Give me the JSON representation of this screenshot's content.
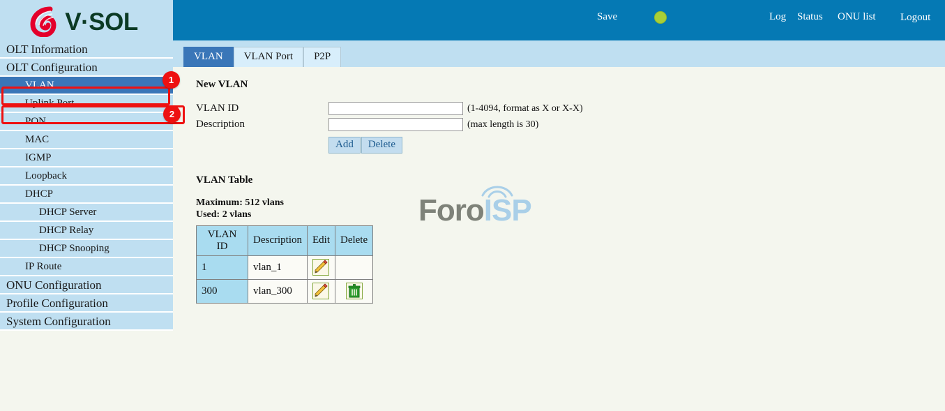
{
  "brand": {
    "logo_text": "V·SOL",
    "logo_icon": "vsol-swirl-logo"
  },
  "header": {
    "save_label": "Save",
    "save_indicator_color": "#a8cf38",
    "links": [
      {
        "label": "Log"
      },
      {
        "label": "Status"
      },
      {
        "label": "ONU list"
      },
      {
        "label": "Logout"
      }
    ]
  },
  "sidebar": {
    "items": [
      {
        "label": "OLT Information",
        "level": 0,
        "selected": false
      },
      {
        "label": "OLT Configuration",
        "level": 0,
        "selected": false
      },
      {
        "label": "VLAN",
        "level": 1,
        "selected": true
      },
      {
        "label": "Uplink Port",
        "level": 1,
        "selected": false
      },
      {
        "label": "PON",
        "level": 1,
        "selected": false
      },
      {
        "label": "MAC",
        "level": 1,
        "selected": false
      },
      {
        "label": "IGMP",
        "level": 1,
        "selected": false
      },
      {
        "label": "Loopback",
        "level": 1,
        "selected": false
      },
      {
        "label": "DHCP",
        "level": 1,
        "selected": false
      },
      {
        "label": "DHCP Server",
        "level": 2,
        "selected": false
      },
      {
        "label": "DHCP Relay",
        "level": 2,
        "selected": false
      },
      {
        "label": "DHCP Snooping",
        "level": 2,
        "selected": false
      },
      {
        "label": "IP Route",
        "level": 1,
        "selected": false
      },
      {
        "label": "ONU Configuration",
        "level": 0,
        "selected": false
      },
      {
        "label": "Profile Configuration",
        "level": 0,
        "selected": false
      },
      {
        "label": "System Configuration",
        "level": 0,
        "selected": false
      }
    ]
  },
  "annotations": {
    "color": "#ee1111",
    "badges": [
      {
        "number": "1",
        "targets": "OLT Configuration"
      },
      {
        "number": "2",
        "targets": "VLAN"
      }
    ]
  },
  "tabs": [
    {
      "label": "VLAN",
      "active": true
    },
    {
      "label": "VLAN Port",
      "active": false
    },
    {
      "label": "P2P",
      "active": false
    }
  ],
  "new_vlan": {
    "title": "New VLAN",
    "fields": [
      {
        "label": "VLAN ID",
        "value": "",
        "placeholder": "",
        "hint": "(1-4094, format as X or X-X)"
      },
      {
        "label": "Description",
        "value": "",
        "placeholder": "",
        "hint": "(max length is 30)"
      }
    ],
    "buttons": [
      {
        "label": "Add"
      },
      {
        "label": "Delete"
      }
    ]
  },
  "vlan_table": {
    "title": "VLAN Table",
    "maximum_line": "Maximum: 512 vlans",
    "used_line": "Used: 2 vlans",
    "columns": [
      "VLAN ID",
      "Description",
      "Edit",
      "Delete"
    ],
    "rows": [
      {
        "vlan_id": "1",
        "description": "vlan_1",
        "edit_icon": "pencil-edit-icon",
        "delete_icon": ""
      },
      {
        "vlan_id": "300",
        "description": "vlan_300",
        "edit_icon": "pencil-edit-icon",
        "delete_icon": "trash-delete-icon"
      }
    ]
  },
  "watermark": {
    "part1": "Foro",
    "part2": "ISP"
  }
}
